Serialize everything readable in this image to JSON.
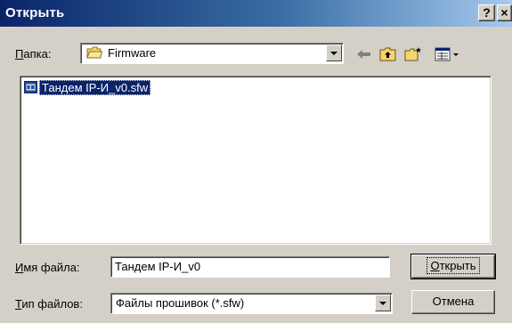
{
  "window": {
    "title": "Открыть",
    "help_button": "?",
    "close_button": "×"
  },
  "folder": {
    "label_hotkey": "П",
    "label_rest": "апка:",
    "value": "Firmware"
  },
  "toolbar": {
    "icons": [
      "back-arrow-icon",
      "up-folder-icon",
      "new-folder-icon",
      "view-menu-icon"
    ]
  },
  "files": [
    {
      "name": "Тандем IP-И_v0.sfw",
      "selected": true,
      "icon": "firmware-file-icon"
    }
  ],
  "filename": {
    "label_hotkey": "И",
    "label_rest": "мя файла:",
    "value": "Тандем IP-И_v0"
  },
  "filetype": {
    "label_hotkey": "Т",
    "label_rest": "ип файлов:",
    "value": "Файлы прошивок (*.sfw)"
  },
  "buttons": {
    "open_hotkey": "О",
    "open_rest": "ткрыть",
    "cancel": "Отмена"
  },
  "colors": {
    "face": "#d4d0c8",
    "title_start": "#0a246a",
    "title_end": "#a6caf0",
    "selection": "#0a246a"
  }
}
